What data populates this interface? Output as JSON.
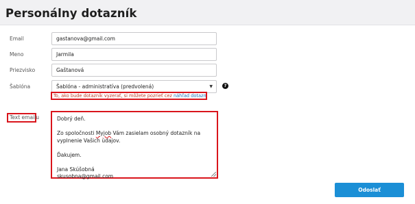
{
  "page": {
    "title": "Personálny dotazník"
  },
  "form": {
    "email": {
      "label": "Email",
      "value": "gastanova@gmail.com"
    },
    "first_name": {
      "label": "Meno",
      "value": "Jarmila"
    },
    "last_name": {
      "label": "Priezvisko",
      "value": "Gaštanová"
    },
    "template": {
      "label": "Šablóna",
      "value": "Šablóna - administratíva (predvolená)",
      "help_icon": "?",
      "hint_text": "To, ako bude dotazník vyzerať, si môžete pozrieť cez ",
      "hint_link": "náhľad dotazníka",
      "hint_end": "."
    },
    "email_text": {
      "label": "Text emailu",
      "line1": "Dobrý deň.",
      "line2a": "Zo spoločnosti ",
      "line2_company": "Myjob",
      "line2b": " Vám zasielam osobný dotazník na vyplnenie Vašich údajov.",
      "line3": "Ďakujem.",
      "line4": "Jana Skúšobná",
      "line5": "skusobna@gmail.com"
    },
    "submit_label": "Odoslať"
  },
  "colors": {
    "accent": "#1b8fd6",
    "highlight": "#d9141b"
  }
}
